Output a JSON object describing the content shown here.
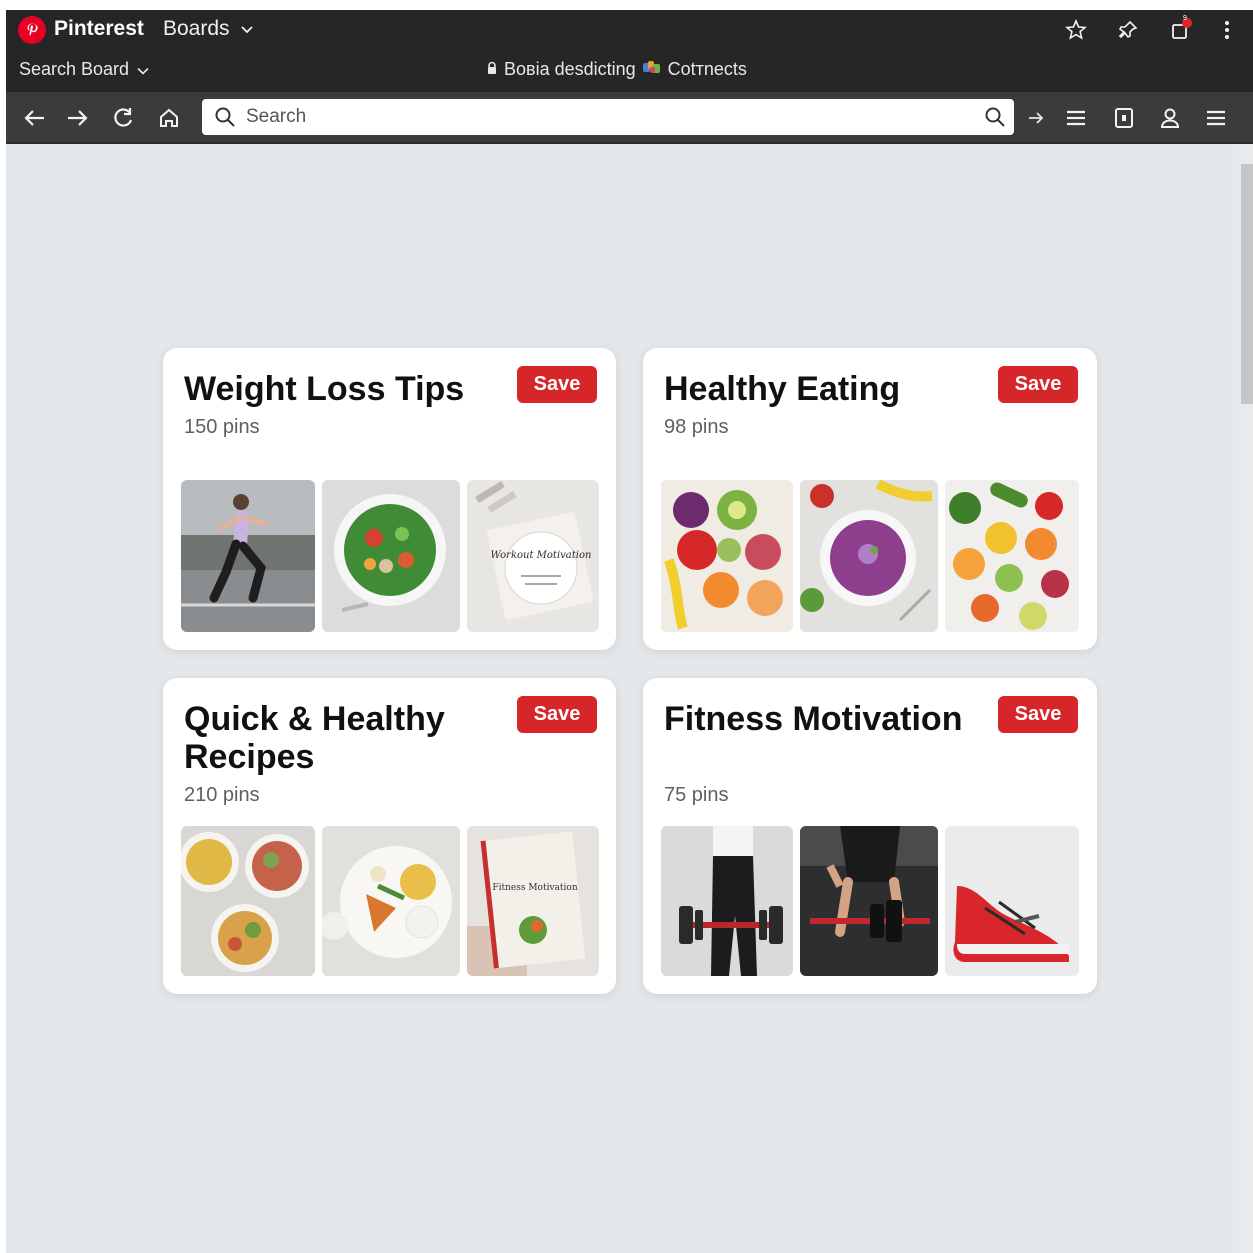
{
  "browser": {
    "brand": "Pinterest",
    "menu": "Boards",
    "search_board": "Search Board",
    "site_title_a": "Bовia desdicting",
    "site_title_b": "Cotтnects",
    "notification_badge": "9"
  },
  "search": {
    "placeholder": "Search"
  },
  "boards": [
    {
      "title": "Weight Loss Tips",
      "pins": "150 pins",
      "save": "Save"
    },
    {
      "title": "Healthy Eating",
      "pins": "98 pins",
      "save": "Save"
    },
    {
      "title": "Quick & Healthy Recipes",
      "pins": "210 pins",
      "save": "Save"
    },
    {
      "title": "Fitness Motivation",
      "pins": "75 pins",
      "save": "Save"
    }
  ],
  "thumb_text": {
    "motivation_card": "Workout Motivation",
    "book_title": "Fitness Motivation"
  },
  "colors": {
    "brand": "#e60023",
    "save_button": "#d6262a",
    "topbar": "#262626",
    "page_bg": "#e5e8ea"
  }
}
